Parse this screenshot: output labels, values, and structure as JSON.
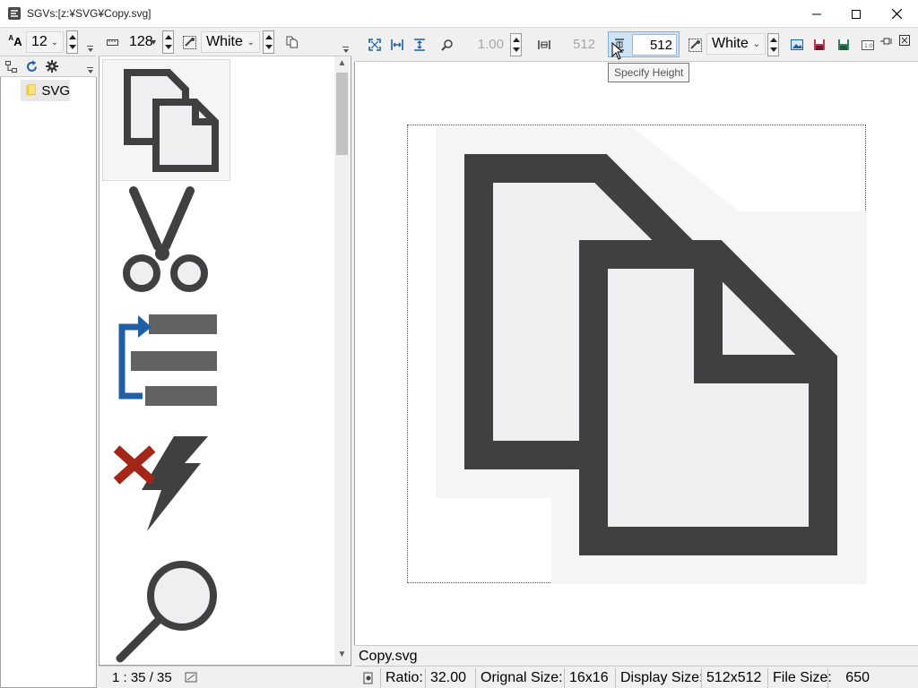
{
  "window": {
    "title": "SGVs:[z:¥SVG¥Copy.svg]"
  },
  "left_toolbar": {
    "font_size_value": "12"
  },
  "middle_toolbar": {
    "thumb_size_value": "128",
    "background_value": "White"
  },
  "tree": {
    "root_label": "SVG"
  },
  "main_toolbar": {
    "ratio_value": "1.00",
    "width_value": "512",
    "height_value": "512",
    "background_value": "White"
  },
  "tooltip": {
    "text": "Specify Height"
  },
  "thumbnail_list": {
    "items": [
      {
        "name": "copy-icon"
      },
      {
        "name": "scissors-icon"
      },
      {
        "name": "list-move-icon"
      },
      {
        "name": "delete-lightning-icon"
      },
      {
        "name": "magnifier-icon"
      }
    ],
    "status_text": "1 : 35 / 35"
  },
  "preview": {
    "filename": "Copy.svg"
  },
  "statusbar": {
    "ratio_label": "Ratio:",
    "ratio_value": "32.00",
    "original_size_label": "Orignal Size:",
    "original_size_value": "16x16",
    "display_size_label": "Display Size:",
    "display_size_value": "512x512",
    "file_size_label": "File Size:",
    "file_size_value": "650"
  },
  "colors": {
    "icon_dark": "#404040",
    "icon_light": "#efeff1",
    "icon_halo": "#f5f5f5",
    "accent_blue": "#1e5fa6",
    "accent_red": "#a42618"
  }
}
